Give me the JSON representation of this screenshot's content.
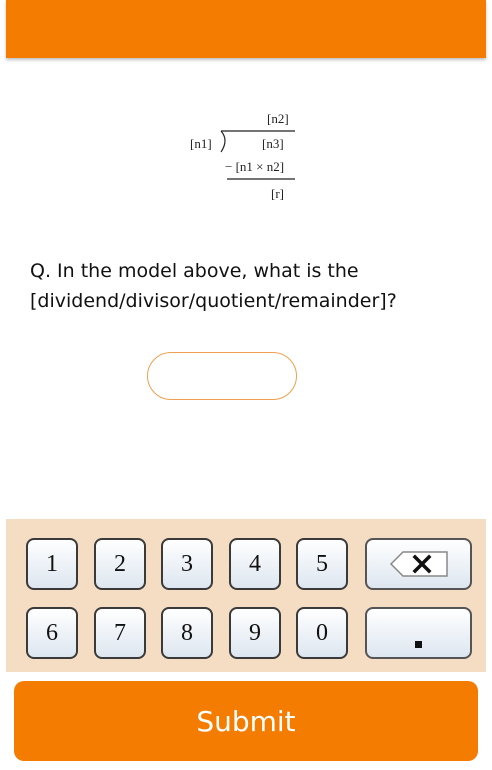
{
  "model": {
    "quotient": "[n2]",
    "divisor": "[n1]",
    "dividend": "[n3]",
    "product": "− [n1 × n2]",
    "remainder": "[r]"
  },
  "question": {
    "line1": "Q. In the model above, what is the",
    "line2": "[dividend/divisor/quotient/remainder]?"
  },
  "answer": {
    "value": ""
  },
  "keypad": {
    "row1": [
      "1",
      "2",
      "3",
      "4",
      "5"
    ],
    "row2": [
      "6",
      "7",
      "8",
      "9",
      "0"
    ],
    "backspace_icon": "backspace-x-icon",
    "decimal_icon": "dot-icon"
  },
  "submit": {
    "label": "Submit"
  },
  "colors": {
    "accent": "#f47c00",
    "keypad_bg": "#f5ddc4",
    "input_border": "#f0a050"
  }
}
